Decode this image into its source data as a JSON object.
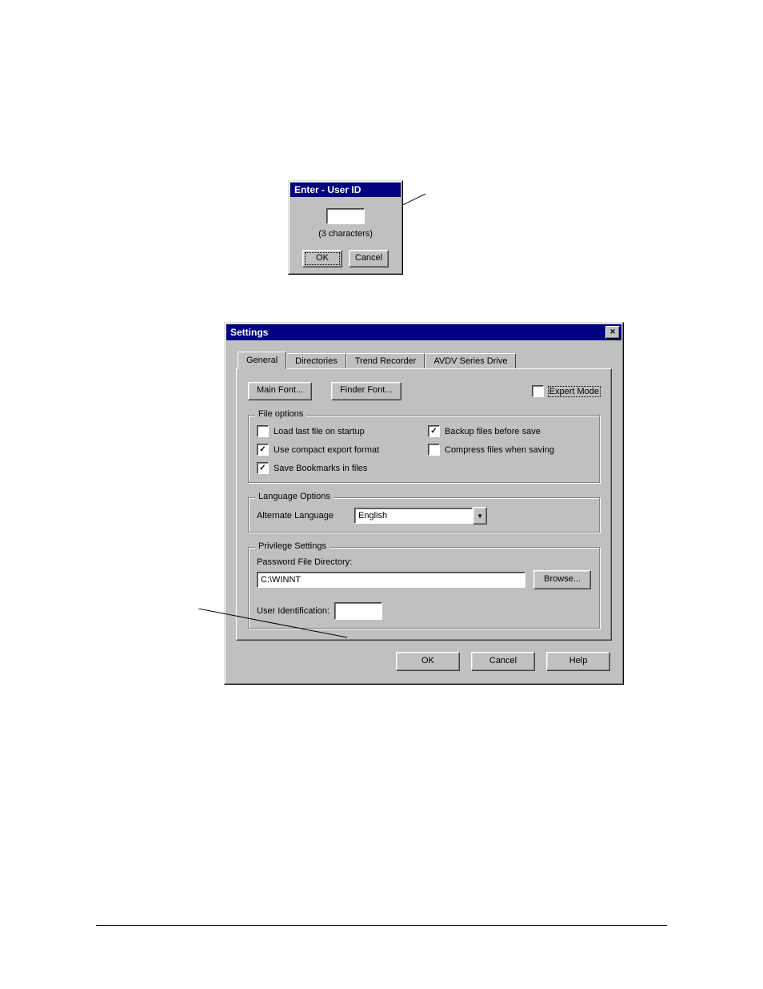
{
  "uid_dialog": {
    "title": "Enter - User ID",
    "hint": "(3 characters)",
    "ok": "OK",
    "cancel": "Cancel"
  },
  "settings": {
    "title": "Settings",
    "close_glyph": "✕",
    "tabs": {
      "general": "General",
      "directories": "Directories",
      "trend": "Trend Recorder",
      "avdv": "AVDV Series Drive"
    },
    "general": {
      "main_font_btn": "Main Font...",
      "finder_font_btn": "Finder Font...",
      "expert_mode": "Expert Mode",
      "file_options": {
        "legend": "File options",
        "load_last": "Load last file on startup",
        "backup": "Backup files before save",
        "compact_export": "Use compact export format",
        "compress": "Compress files when saving",
        "save_bookmarks": "Save Bookmarks in files"
      },
      "language_options": {
        "legend": "Language Options",
        "alt_lang_label": "Alternate Language",
        "alt_lang_value": "English"
      },
      "privilege": {
        "legend": "Privilege Settings",
        "pwd_dir_label": "Password File Directory:",
        "pwd_dir_value": "C:\\WINNT",
        "browse": "Browse...",
        "user_id_label": "User Identification:"
      }
    },
    "buttons": {
      "ok": "OK",
      "cancel": "Cancel",
      "help": "Help"
    }
  },
  "icons": {
    "dropdown": "▼",
    "check": "✓"
  }
}
